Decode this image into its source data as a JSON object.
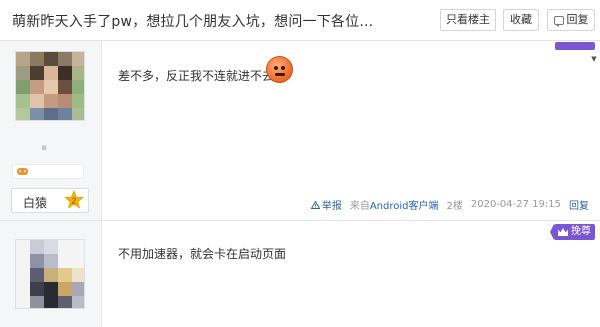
{
  "header": {
    "title": "萌新昨天入手了pw，想拉几个朋友入坑，想问一下各位...",
    "only_op_label": "只看楼主",
    "favorite_label": "收藏",
    "reply_label": "回复"
  },
  "posts": [
    {
      "username": "▪",
      "level_name": "白猿",
      "level_num": "2",
      "content": "差不多，反正我不连就进不去",
      "meta": {
        "report_label": "举报",
        "client_prefix": "来自",
        "client_name": "Android客户端",
        "floor": "2楼",
        "datetime": "2020-04-27 19:15",
        "reply_label": "回复"
      }
    },
    {
      "content": "不用加速器，就会卡在启动页面",
      "tag_label": "挽尊"
    }
  ],
  "colors": {
    "accent_purple": "#7a57d1",
    "link_blue": "#2d64b3",
    "level_star": "#f5b400"
  }
}
